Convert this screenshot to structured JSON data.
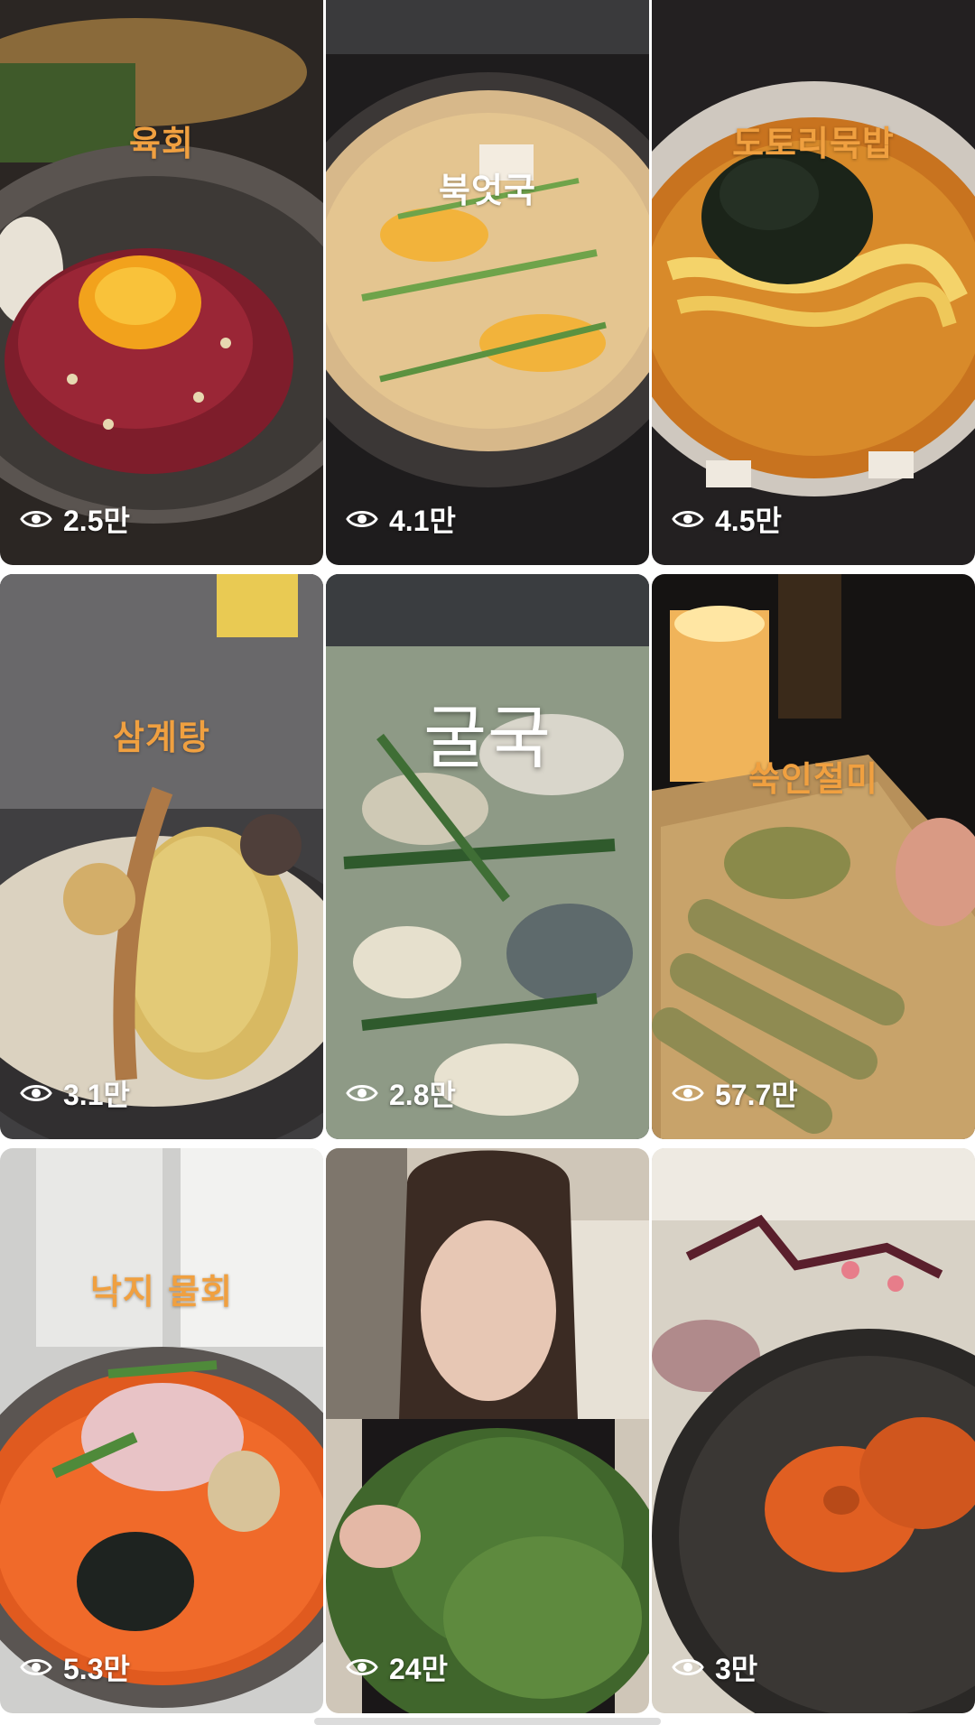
{
  "tiles": [
    {
      "caption": "육회",
      "views": "2.5만",
      "caption_color": "#f0a040"
    },
    {
      "caption": "북엇국",
      "views": "4.1만",
      "caption_color": "#ffffff"
    },
    {
      "caption": "도토리묵밥",
      "views": "4.5만",
      "caption_color": "#f0a040"
    },
    {
      "caption": "삼계탕",
      "views": "3.1만",
      "caption_color": "#f0a040"
    },
    {
      "caption": "굴국",
      "views": "2.8만",
      "caption_color": "#ffffff"
    },
    {
      "caption": "쑥인절미",
      "views": "57.7만",
      "caption_color": "#f0a040"
    },
    {
      "caption": "낙지 물회",
      "views": "5.3만",
      "caption_color": "#f0a040"
    },
    {
      "caption": "",
      "views": "24만",
      "caption_color": "#ffffff"
    },
    {
      "caption": "",
      "views": "3만",
      "caption_color": "#ffffff"
    }
  ],
  "icons": {
    "views": "eye-icon"
  }
}
